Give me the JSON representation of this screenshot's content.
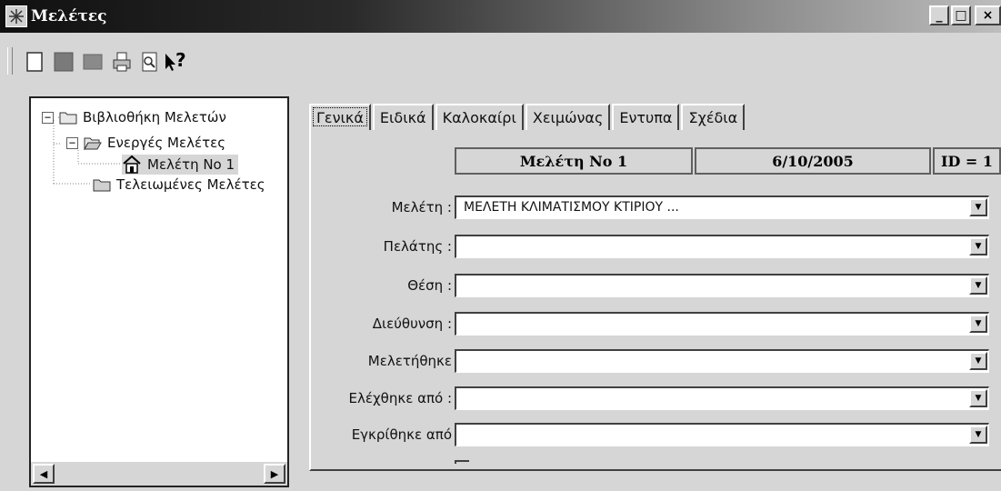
{
  "window": {
    "title": "Μελέτες",
    "minimize_label": "_",
    "maximize_label": "□",
    "close_label": "×"
  },
  "toolbar": {
    "buttons": [
      {
        "icon": "new-document-icon"
      },
      {
        "icon": "open-icon"
      },
      {
        "icon": "save-icon"
      },
      {
        "icon": "print-icon"
      },
      {
        "icon": "preview-icon"
      },
      {
        "icon": "context-help-icon",
        "label": "?"
      }
    ]
  },
  "tree": {
    "root": {
      "label": "Βιβλιοθήκη Μελετών",
      "expander": "−"
    },
    "active_group": {
      "label": "Ενεργές Μελέτες",
      "expander": "−"
    },
    "selected_item": {
      "label": "Μελέτη Νο 1"
    },
    "completed_group": {
      "label": "Τελειωμένες Μελέτες"
    }
  },
  "tabs": [
    "Γενικά",
    "Ειδικά",
    "Καλοκαίρι",
    "Χειμώνας",
    "Εντυπα",
    "Σχέδια"
  ],
  "active_tab": "Γενικά",
  "header": {
    "study_name": "Μελέτη Νο 1",
    "date": "6/10/2005",
    "id": "ID = 1"
  },
  "form": {
    "fields": [
      {
        "label": "Μελέτη :",
        "value": "ΜΕΛΕΤΗ ΚΛΙΜΑΤΙΣΜΟΥ ΚΤΙΡΙΟΥ ..."
      },
      {
        "label": "Πελάτης :",
        "value": ""
      },
      {
        "label": "Θέση :",
        "value": ""
      },
      {
        "label": "Διεύθυνση :",
        "value": ""
      },
      {
        "label": "Μελετήθηκε",
        "value": ""
      },
      {
        "label": "Ελέχθηκε από :",
        "value": ""
      },
      {
        "label": "Εγκρίθηκε από",
        "value": ""
      }
    ]
  },
  "colors": {
    "window_bg": "#d6d6d6",
    "title_start": "#101010",
    "title_end": "#bdbdbd"
  }
}
